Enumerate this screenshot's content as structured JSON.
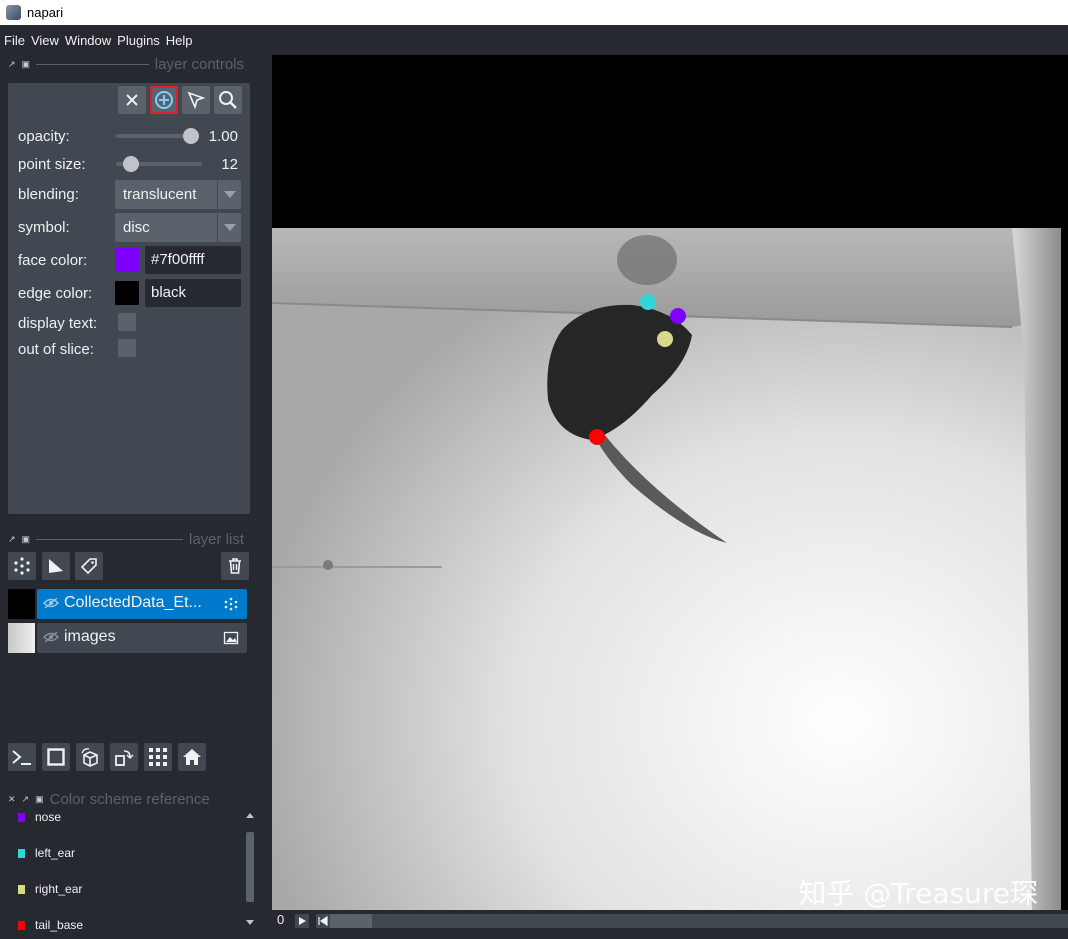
{
  "window": {
    "title": "napari"
  },
  "menu": [
    "File",
    "View",
    "Window",
    "Plugins",
    "Help"
  ],
  "layer_controls": {
    "dock_title": "layer controls",
    "tools": [
      "delete-selected-points",
      "add-points",
      "select-points",
      "pan-zoom"
    ],
    "opacity": {
      "label": "opacity:",
      "value": "1.00",
      "fraction": 1.0
    },
    "point_size": {
      "label": "point size:",
      "value": "12",
      "fraction": 0.1
    },
    "blending": {
      "label": "blending:",
      "value": "translucent"
    },
    "symbol": {
      "label": "symbol:",
      "value": "disc"
    },
    "face_color": {
      "label": "face color:",
      "value": "#7f00ffff",
      "swatch": "#7f00ff"
    },
    "edge_color": {
      "label": "edge color:",
      "value": "black",
      "swatch": "#000000"
    },
    "display_text": {
      "label": "display text:",
      "checked": false
    },
    "out_of_slice": {
      "label": "out of slice:",
      "checked": false
    }
  },
  "layer_list": {
    "dock_title": "layer list",
    "layers": [
      {
        "name": "CollectedData_Et...",
        "type": "points",
        "selected": true
      },
      {
        "name": "images",
        "type": "image",
        "selected": false
      }
    ]
  },
  "color_scheme": {
    "dock_title": "Color scheme reference",
    "items": [
      {
        "label": "nose",
        "color": "#7f00ff"
      },
      {
        "label": "left_ear",
        "color": "#33d6d6"
      },
      {
        "label": "right_ear",
        "color": "#d9d98c"
      },
      {
        "label": "tail_base",
        "color": "#ff0000"
      }
    ]
  },
  "canvas": {
    "keypoints": [
      {
        "name": "left_ear",
        "color": "#33d6d6"
      },
      {
        "name": "nose",
        "color": "#7f00ff"
      },
      {
        "name": "right_ear",
        "color": "#d9d98c"
      },
      {
        "name": "tail_base",
        "color": "#ff0000"
      }
    ],
    "watermark": "知乎 @Treasure琛"
  },
  "dims": {
    "index": "0"
  }
}
